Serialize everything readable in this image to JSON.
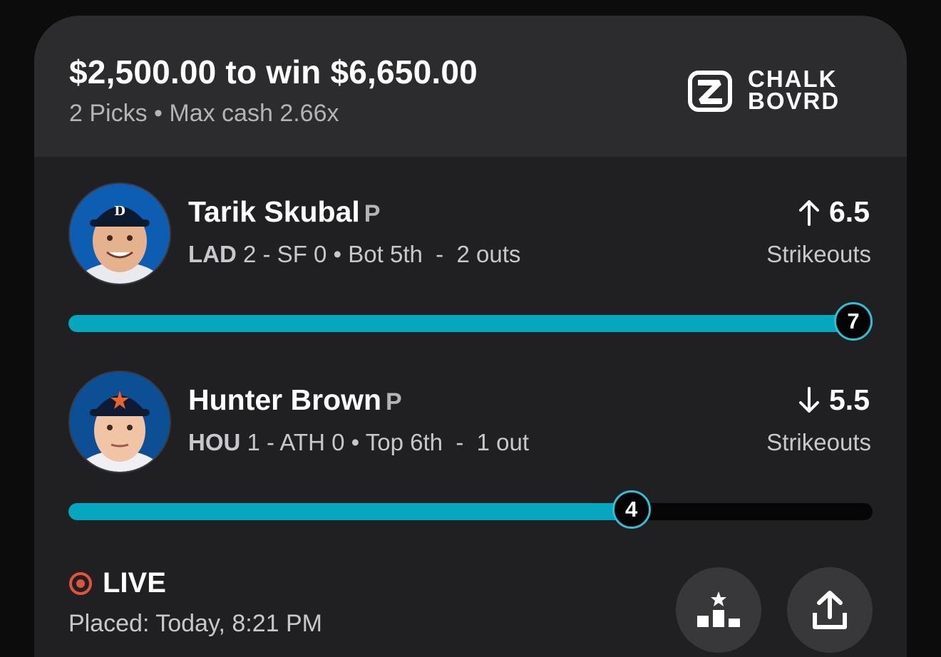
{
  "header": {
    "title": "$2,500.00 to win $6,650.00",
    "subtitle": "2 Picks • Max cash 2.66x",
    "brand_line1": "CHALK",
    "brand_line2": "BOVRD",
    "brand_icon": "chalkboard-logo-icon"
  },
  "picks": [
    {
      "player": "Tarik Skubal",
      "position": "P",
      "team": "LAD",
      "game_score": "2 - SF 0 • Bot 5th  -  2 outs",
      "direction": "up",
      "direction_icon": "arrow-up-icon",
      "line": "6.5",
      "stat": "Strikeouts",
      "current": "7",
      "progress_fraction": 1.0
    },
    {
      "player": "Hunter Brown",
      "position": "P",
      "team": "HOU",
      "game_score": "1 - ATH 0 • Top 6th  -  1 out",
      "direction": "down",
      "direction_icon": "arrow-down-icon",
      "line": "5.5",
      "stat": "Strikeouts",
      "current": "4",
      "progress_fraction": 0.7
    }
  ],
  "status": {
    "live_label": "LIVE",
    "placed": "Placed: Today, 8:21 PM"
  },
  "actions": {
    "leaderboard_icon": "leaderboard-icon",
    "share_icon": "share-icon"
  },
  "colors": {
    "accent": "#05a7be",
    "live": "#e2533f",
    "card": "#232325"
  }
}
